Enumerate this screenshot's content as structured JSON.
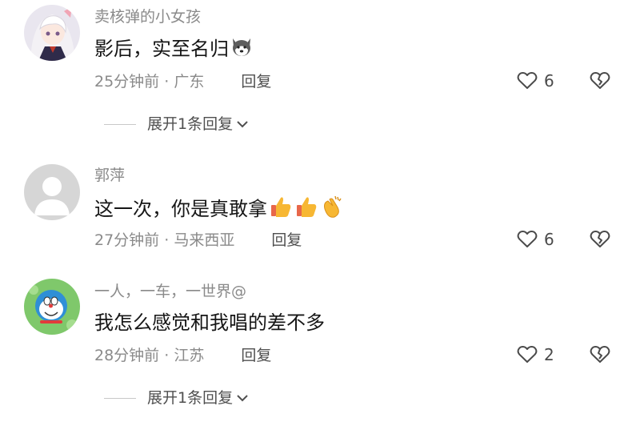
{
  "comments": [
    {
      "username": "卖核弹的小女孩",
      "text": "影后，实至名归",
      "emoji_icons": [
        "husky-dog-face-icon"
      ],
      "time": "25分钟前",
      "separator": "·",
      "location": "广东",
      "reply_label": "回复",
      "like_count": "6",
      "expand_label": "展开1条回复"
    },
    {
      "username": "郭萍",
      "text": "这一次，你是真敢拿",
      "emoji_icons": [
        "thumbs-up-icon",
        "thumbs-up-icon",
        "clapping-hands-icon"
      ],
      "time": "27分钟前",
      "separator": "·",
      "location": "马来西亚",
      "reply_label": "回复",
      "like_count": "6"
    },
    {
      "username": "一人，一车，一世界@",
      "text": "我怎么感觉和我唱的差不多",
      "emoji_icons": [],
      "time": "28分钟前",
      "separator": "·",
      "location": "江苏",
      "reply_label": "回复",
      "like_count": "2",
      "expand_label": "展开1条回复"
    }
  ],
  "colors": {
    "secondary_text": "#8a8a8a",
    "primary_text": "#161616",
    "icon": "#4a4a4a"
  }
}
